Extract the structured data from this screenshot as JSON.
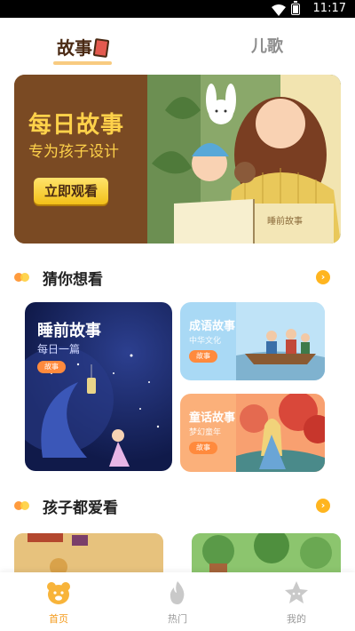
{
  "status_bar": {
    "time": "11:17"
  },
  "top_tabs": [
    {
      "label": "故事",
      "active": true
    },
    {
      "label": "儿歌",
      "active": false
    }
  ],
  "banner": {
    "title": "每日故事",
    "subtitle": "专为孩子设计",
    "cta": "立即观看",
    "book_text": "睡前故事"
  },
  "section_1": {
    "title": "猜你想看",
    "cards": [
      {
        "title": "睡前故事",
        "subtitle": "每日一篇",
        "tag": "故事"
      },
      {
        "title": "成语故事",
        "subtitle": "中华文化",
        "tag": "故事"
      },
      {
        "title": "童话故事",
        "subtitle": "梦幻童年",
        "tag": "故事"
      }
    ]
  },
  "section_2": {
    "title": "孩子都爱看"
  },
  "bottom_nav": [
    {
      "label": "首页",
      "icon": "bear-home-icon",
      "active": true
    },
    {
      "label": "热门",
      "icon": "flame-icon",
      "active": false
    },
    {
      "label": "我的",
      "icon": "star-face-icon",
      "active": false
    }
  ],
  "colors": {
    "accent": "#f49a1a",
    "banner_bg": "#7a4a23",
    "banner_text": "#ffd24a"
  }
}
